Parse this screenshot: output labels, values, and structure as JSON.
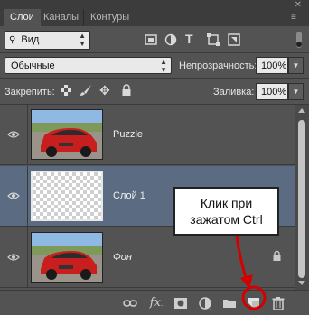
{
  "tabs": [
    {
      "label": "Слои",
      "active": true
    },
    {
      "label": "Каналы",
      "active": false
    },
    {
      "label": "Контуры",
      "active": false
    }
  ],
  "filter": {
    "label": "Вид"
  },
  "blend_mode": {
    "value": "Обычные"
  },
  "opacity": {
    "label": "Непрозрачность:",
    "value": "100%"
  },
  "lock": {
    "label": "Закрепить:"
  },
  "fill": {
    "label": "Заливка:",
    "value": "100%"
  },
  "layers": [
    {
      "name": "Puzzle",
      "selected": false,
      "italic": false,
      "locked": false
    },
    {
      "name": "Слой 1",
      "selected": true,
      "italic": false,
      "locked": false
    },
    {
      "name": "Фон",
      "selected": false,
      "italic": true,
      "locked": true
    }
  ],
  "callout": {
    "line1": "Клик при",
    "line2": "зажатом Ctrl"
  },
  "colors": {
    "panel": "#535353",
    "tabbar": "#3c3c3c",
    "selected_row": "#5b6c82",
    "annotation": "#d40000"
  },
  "icons": [
    "eye-icon",
    "lock-icon",
    "link-layers-icon",
    "fx-icon",
    "mask-icon",
    "adjustment-icon",
    "folder-icon",
    "new-layer-icon",
    "trash-icon"
  ]
}
